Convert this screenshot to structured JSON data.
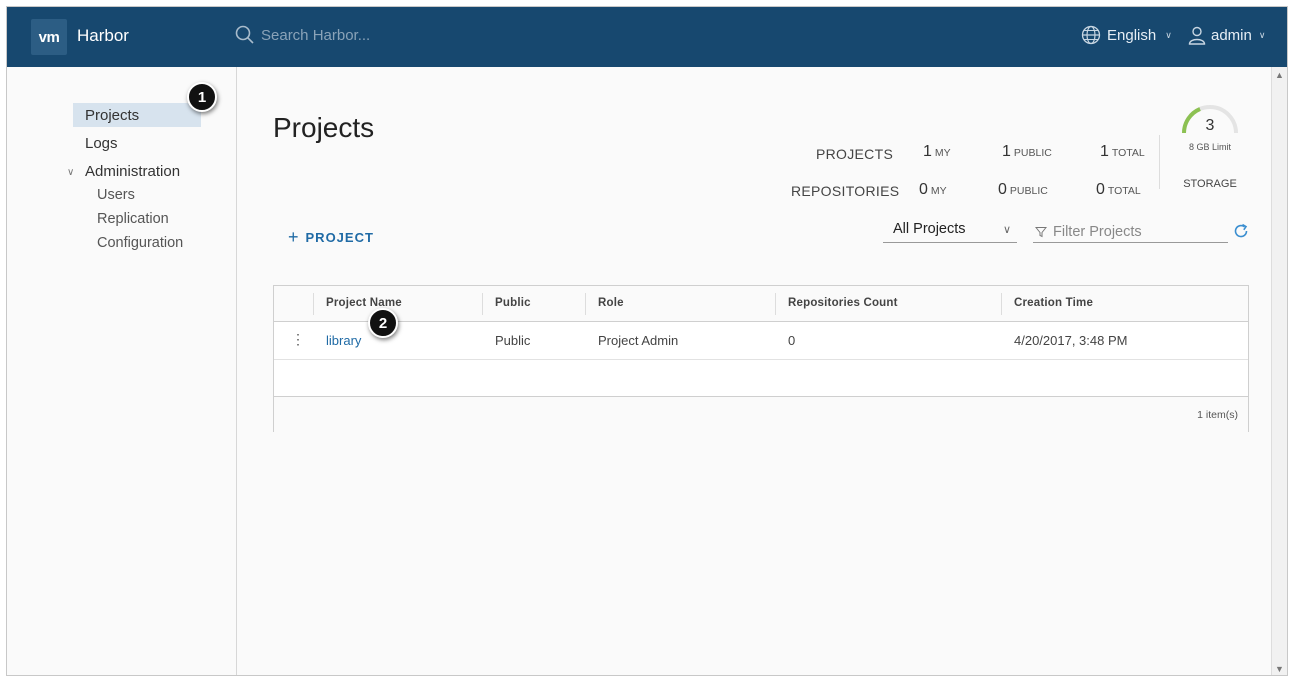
{
  "header": {
    "logo": "vm",
    "brand": "Harbor",
    "search_placeholder": "Search Harbor...",
    "language": "English",
    "user": "admin"
  },
  "sidebar": {
    "items": [
      {
        "label": "Projects"
      },
      {
        "label": "Logs"
      },
      {
        "label": "Administration"
      }
    ],
    "admin_items": [
      {
        "label": "Users"
      },
      {
        "label": "Replication"
      },
      {
        "label": "Configuration"
      }
    ]
  },
  "markers": [
    "1",
    "2"
  ],
  "main": {
    "title": "Projects",
    "stats": {
      "projects_label": "PROJECTS",
      "repositories_label": "REPOSITORIES",
      "projects": {
        "my": "1",
        "public": "1",
        "total": "1"
      },
      "repositories": {
        "my": "0",
        "public": "0",
        "total": "0"
      },
      "my_label": "MY",
      "public_label": "PUBLIC",
      "total_label": "TOTAL",
      "storage_value": "3",
      "storage_limit": "8 GB Limit",
      "storage_label": "STORAGE",
      "storage_fraction": 0.375
    },
    "add_project_label": "PROJECT",
    "filter_select": "All Projects",
    "filter_placeholder": "Filter Projects",
    "table": {
      "columns": [
        "Project Name",
        "Public",
        "Role",
        "Repositories Count",
        "Creation Time"
      ],
      "rows": [
        {
          "name": "library",
          "public": "Public",
          "role": "Project Admin",
          "repos": "0",
          "created": "4/20/2017, 3:48 PM"
        }
      ],
      "footer": "1 item(s)"
    }
  },
  "colors": {
    "header_bg": "#17486f",
    "link": "#1f6aa5",
    "active_nav": "#d7e3ee",
    "gauge": "#8cc152"
  }
}
